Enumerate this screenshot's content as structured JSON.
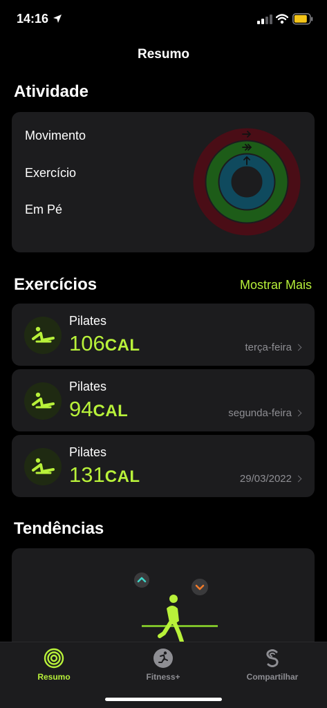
{
  "status": {
    "time": "14:16"
  },
  "nav": {
    "title": "Resumo"
  },
  "activity": {
    "title": "Atividade",
    "rings": [
      {
        "label": "Movimento",
        "color": "#e2233e",
        "progress": 0.02
      },
      {
        "label": "Exercício",
        "color": "#a6f23a",
        "progress": 0.02
      },
      {
        "label": "Em Pé",
        "color": "#33d1ea",
        "progress": 0.01
      }
    ]
  },
  "workouts": {
    "title": "Exercícios",
    "show_more": "Mostrar Mais",
    "items": [
      {
        "name": "Pilates",
        "calories": "106",
        "unit": "CAL",
        "date": "terça-feira"
      },
      {
        "name": "Pilates",
        "calories": "94",
        "unit": "CAL",
        "date": "segunda-feira"
      },
      {
        "name": "Pilates",
        "calories": "131",
        "unit": "CAL",
        "date": "29/03/2022"
      }
    ]
  },
  "trends": {
    "title": "Tendências"
  },
  "tabs": [
    {
      "label": "Resumo",
      "icon": "rings-icon",
      "active": true
    },
    {
      "label": "Fitness+",
      "icon": "running-person-icon",
      "active": false
    },
    {
      "label": "Compartilhar",
      "icon": "share-rings-icon",
      "active": false
    }
  ],
  "colors": {
    "accent": "#b8f13a",
    "card": "#1c1c1e",
    "background": "#000000"
  }
}
